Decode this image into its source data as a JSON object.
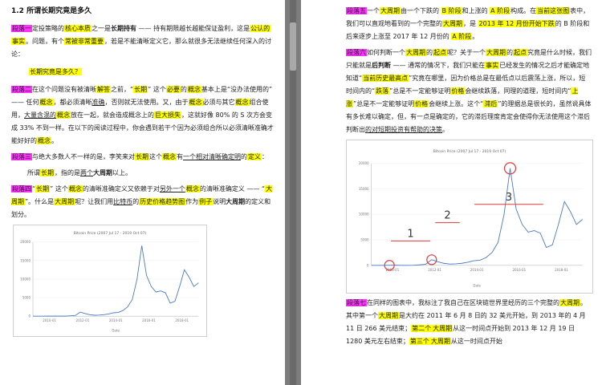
{
  "left_page": {
    "heading": "1.2 所谓长期究竟是多久",
    "p1": {
      "tag": "段落一",
      "a": "定投策略的",
      "b": "核心本质",
      "c": "之一是",
      "d": "长期持有",
      "e": " —— 持有期限越长越能保证盈利，这是",
      "f": "公认的",
      "g": "事实",
      "h": "。问题，有个",
      "i": "常被非常重要",
      "j": "，若是不能清晰定义它，那么就很多无法继续任何深入的讨论："
    },
    "quote": "长期究竟是多久？",
    "p2": {
      "tag": "段落二",
      "a": "在这个问题没有被清晰",
      "b": "解答",
      "c": "之前，“",
      "d": "长期",
      "e": "” 这个",
      "f": "必要",
      "g": "的",
      "h": "概念",
      "i": "基本上是“没办法使用的” —— 任何",
      "j": "概念",
      "k": "，都必须清晰",
      "l": "准确",
      "m": "，否则就无法使用。又，由于",
      "n": "概念",
      "o": "必须与其它",
      "p": "概念",
      "q": "组合使用，",
      "r": "大量含混的",
      "s": "概念",
      "t": "放在一起，就会造成概念上的",
      "u": "巨大损失",
      "v": "，这就好像 80% 的 S 次方会变成 33% 不到一样。在以下的阅读过程中，你会遇到若干个因为必须组合所以必须清晰准确才能好好的",
      "w": "概念",
      "x": "。"
    },
    "p3": {
      "tag": "段落三",
      "a": "与绝大多数人不一样的是，李笑来对",
      "b": "长期",
      "c": "这个",
      "d": "概念",
      "e": "有",
      "f": "一个相对清晰确定",
      "g": "明",
      "h": "的",
      "i": "定义",
      "j": "："
    },
    "def": {
      "a": "所谓",
      "b": "长期",
      "c": "，指的是",
      "d": "两个",
      "e": "大周期",
      "f": "以上。"
    },
    "p4": {
      "tag": "段落四",
      "a": "“",
      "b": "长期",
      "c": "” 这个",
      "d": "概念",
      "e": "的清晰准确定义又依赖于对",
      "f": "另外一个",
      "g": "概念",
      "h": "的清晰准确定义 —— “",
      "i": "大周期",
      "j": "”。什么是",
      "k": "大周期",
      "l": "呢？让我们用",
      "m": "比特币",
      "n": "的",
      "o": "历史价格趋势图",
      "p": "作为",
      "q": "例子",
      "r": "说明",
      "s": "大周期",
      "t": "的定义和划分。"
    }
  },
  "right_page": {
    "p5": {
      "tag": "段落五",
      "a": "一个",
      "b": "大周期",
      "c": "由一个下跌的 ",
      "d": "B 阶段",
      "e": "和上涨的 ",
      "f": "A 阶段",
      "g": "构成。在",
      "h": "当前这张图",
      "i": "表中",
      "j": "，我们可以直观地看到的一个完整的",
      "k": "大周期",
      "l": "，是 ",
      "m": "2013 年 12 月份开始下跌",
      "n": "的 B 阶段和后来逐步上涨至 2017 年 12 月份的 ",
      "o": "A 阶段",
      "p": "。"
    },
    "p6": {
      "tag": "段落六",
      "a": "如何判断一个",
      "b": "大周期",
      "c": "的",
      "d": "起点",
      "e": "呢？关于一个",
      "f": "大周期",
      "g": "的",
      "h": "起点",
      "i": "究竟是什么时候，我们只能就是",
      "j": "后判断",
      "k": " —— 通常的情况下，我们只能在",
      "l": "事实",
      "m": "已经发生的情况之后才能确定地知道“",
      "n": "当前历史最高点",
      "o": "”究竟在哪里，因为价格总是在最低点以后震荡上涨，所以，短时间内的“",
      "p": "跌落",
      "q": "”总是不一定能够证明",
      "r": "价格",
      "s": "会继续跌落，同理的道理，短时间内“",
      "t": "上涨",
      "u": "”总是不一定能够证明",
      "v": "价格",
      "w": "会继续上涨。这个“",
      "x": "滞后",
      "y": "”的理据总是很长的，虽然说具体有多长难以确定，但，有一点是确定的，它的滞后理度肯定会使得你无法使用这个滞后判断出",
      "z": "的对短期投资有帮助的决策",
      "zz": "。"
    },
    "p7": {
      "tag": "段落七",
      "a": "在同样的图表中，我标注了我自己在区块链世界里经历的三个完整的",
      "b": "大周期",
      "c": "。其中第一个",
      "d": "大周期",
      "e": "是大约在 2011 年 6 月 8 日的 32 美元开始，到 2013 年的 4 月 11 日 266 美元结束；",
      "f": "第二个",
      "g": "大周期",
      "h": "从这一时间点开始到 2013 年 12 月 19 日 1280 美元左右结束；",
      "i": "第三个",
      "j": "大周期",
      "k": "从这一时间点开始"
    }
  },
  "chart_data": [
    {
      "type": "line",
      "title": "Bitcoin Price (2007 Jul 17 - 2019 Oct 07)",
      "xlabel": "Date",
      "ylabel": "",
      "x_ticks": [
        "2010-01",
        "2012-01",
        "2014-01",
        "2016-01",
        "2018-01"
      ],
      "y_ticks": [
        "0",
        "5000",
        "10000",
        "15000",
        "20000"
      ],
      "ylim": [
        0,
        20000
      ],
      "series": [
        {
          "values": [
            0,
            0,
            0,
            10,
            30,
            5,
            5,
            10,
            100,
            200,
            1100,
            700,
            400,
            250,
            300,
            400,
            600,
            900,
            1000,
            1500,
            2500,
            4500,
            10000,
            19000,
            11000,
            8000,
            6500,
            6800,
            6300,
            3500,
            4000,
            8000,
            12500,
            10500,
            8000,
            9000
          ]
        }
      ],
      "color": "#4a79c9"
    },
    {
      "type": "line",
      "title": "Bitcoin Price (2007 Jul 17 - 2019 Oct 07)",
      "xlabel": "Date",
      "ylabel": "",
      "x_ticks": [
        "2010-01",
        "2012-01",
        "2014-01",
        "2016-01",
        "2018-01"
      ],
      "y_ticks": [
        "0",
        "5000",
        "10000",
        "15000",
        "20000"
      ],
      "ylim": [
        0,
        20000
      ],
      "series": [
        {
          "values": [
            0,
            0,
            0,
            10,
            30,
            5,
            5,
            10,
            100,
            200,
            1100,
            700,
            400,
            250,
            300,
            400,
            600,
            900,
            1000,
            1500,
            2500,
            4500,
            10000,
            19000,
            11000,
            8000,
            6500,
            6800,
            6300,
            3500,
            4000,
            8000,
            12500,
            10500,
            8000,
            9000
          ]
        }
      ],
      "annotations": [
        "1",
        "2",
        "3"
      ],
      "color": "#4a79c9",
      "annotation_color": "#e03a3a"
    }
  ]
}
